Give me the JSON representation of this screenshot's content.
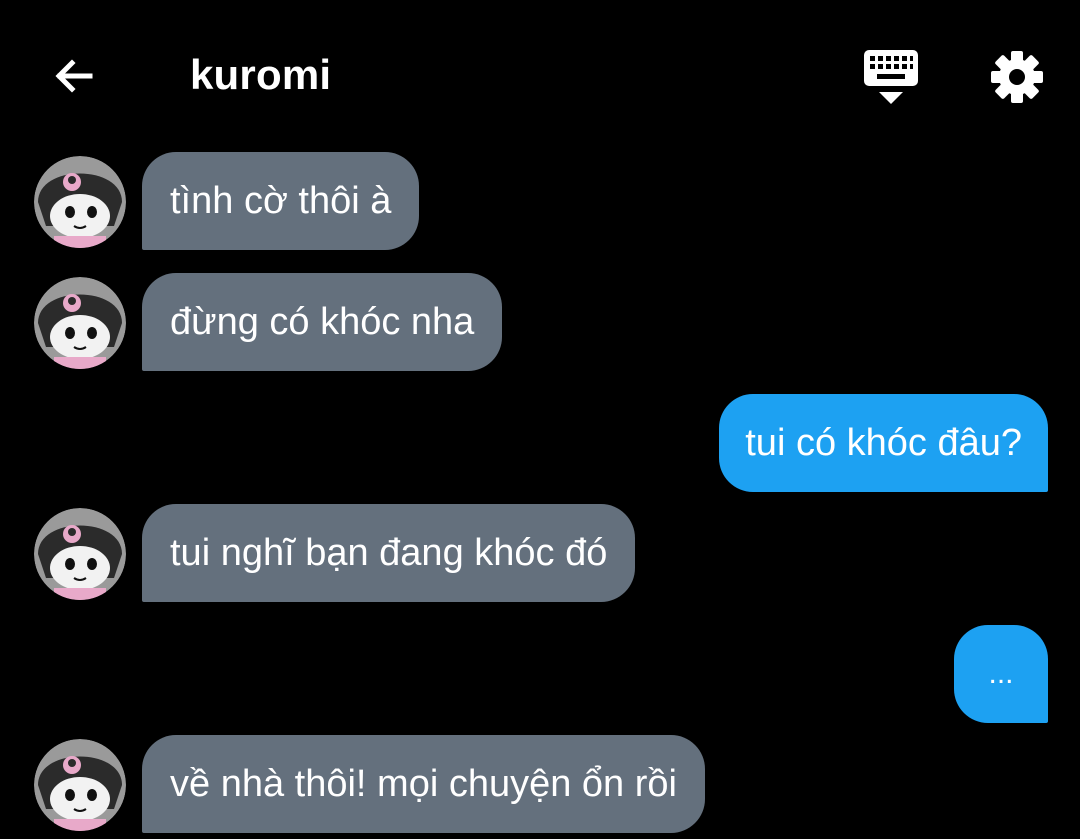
{
  "header": {
    "title": "kuromi",
    "back_icon": "arrow-left-icon",
    "keyboard_icon": "keyboard-hide-icon",
    "settings_icon": "gear-icon"
  },
  "colors": {
    "background": "#000000",
    "incoming_bubble": "#64707d",
    "outgoing_bubble": "#1da1f2",
    "text": "#ffffff"
  },
  "messages": [
    {
      "sender": "kuromi",
      "direction": "incoming",
      "text": "tình cờ thôi à"
    },
    {
      "sender": "kuromi",
      "direction": "incoming",
      "text": "đừng có khóc nha"
    },
    {
      "sender": "me",
      "direction": "outgoing",
      "text": "tui có khóc đâu?"
    },
    {
      "sender": "kuromi",
      "direction": "incoming",
      "text": "tui nghĩ bạn đang khóc đó"
    },
    {
      "sender": "me",
      "direction": "outgoing",
      "text": "..."
    },
    {
      "sender": "kuromi",
      "direction": "incoming",
      "text": "về nhà thôi! mọi chuyện ổn rồi"
    }
  ]
}
